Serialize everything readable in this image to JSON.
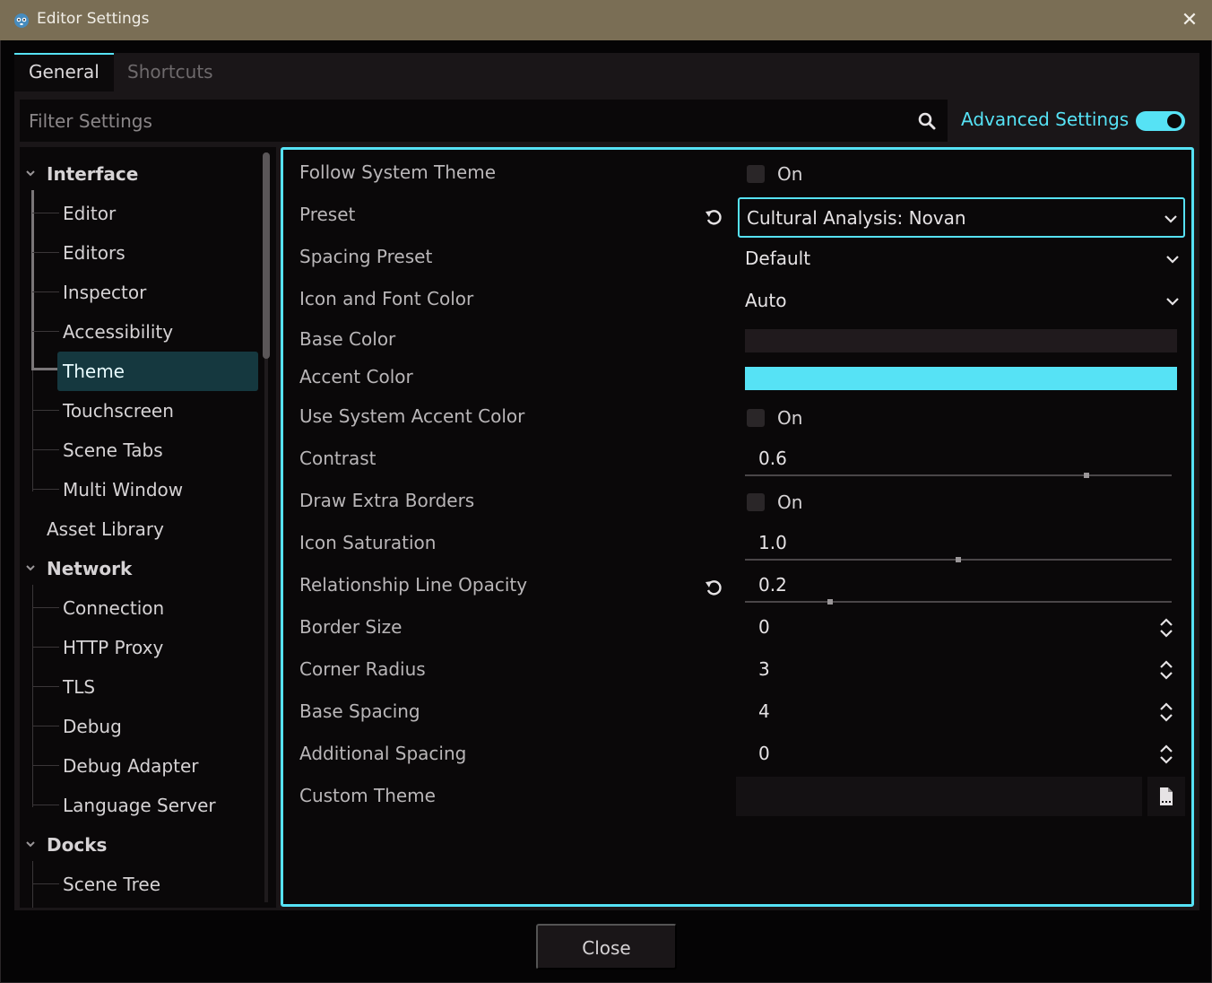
{
  "window": {
    "title": "Editor Settings",
    "close_glyph": "✕",
    "icon": "godot-icon"
  },
  "tabs": [
    {
      "label": "General",
      "active": true
    },
    {
      "label": "Shortcuts",
      "active": false
    }
  ],
  "filter": {
    "placeholder": "Filter Settings",
    "value": ""
  },
  "advanced": {
    "label": "Advanced Settings",
    "enabled": true
  },
  "tree": {
    "categories": [
      {
        "label": "Interface",
        "expanded": true,
        "children": [
          "Editor",
          "Editors",
          "Inspector",
          "Accessibility",
          "Theme",
          "Touchscreen",
          "Scene Tabs",
          "Multi Window"
        ]
      },
      {
        "label": "Asset Library",
        "expanded": false,
        "children": []
      },
      {
        "label": "Network",
        "expanded": true,
        "children": [
          "Connection",
          "HTTP Proxy",
          "TLS",
          "Debug",
          "Debug Adapter",
          "Language Server"
        ]
      },
      {
        "label": "Docks",
        "expanded": true,
        "children": [
          "Scene Tree"
        ]
      }
    ],
    "selected": "Theme"
  },
  "properties": {
    "follow_system_theme": {
      "label": "Follow System Theme",
      "value_label": "On",
      "checked": false
    },
    "preset": {
      "label": "Preset",
      "value": "Cultural Analysis: Novan"
    },
    "spacing_preset": {
      "label": "Spacing Preset",
      "value": "Default"
    },
    "icon_font_color": {
      "label": "Icon and Font Color",
      "value": "Auto"
    },
    "base_color": {
      "label": "Base Color",
      "color": "#201a1d"
    },
    "accent_color": {
      "label": "Accent Color",
      "color": "#56e2f5"
    },
    "use_system_accent": {
      "label": "Use System Accent Color",
      "value_label": "On",
      "checked": false
    },
    "contrast": {
      "label": "Contrast",
      "value": "0.6",
      "fraction": 0.8
    },
    "draw_extra_borders": {
      "label": "Draw Extra Borders",
      "value_label": "On",
      "checked": false
    },
    "icon_saturation": {
      "label": "Icon Saturation",
      "value": "1.0",
      "fraction": 0.5
    },
    "relationship_line_opacity": {
      "label": "Relationship Line Opacity",
      "value": "0.2",
      "fraction": 0.2
    },
    "border_size": {
      "label": "Border Size",
      "value": "0"
    },
    "corner_radius": {
      "label": "Corner Radius",
      "value": "3"
    },
    "base_spacing": {
      "label": "Base Spacing",
      "value": "4"
    },
    "additional_spacing": {
      "label": "Additional Spacing",
      "value": "0"
    },
    "custom_theme": {
      "label": "Custom Theme",
      "value": ""
    }
  },
  "footer": {
    "close_label": "Close"
  },
  "colors": {
    "accent": "#56e2f5",
    "titlebar": "#7a6e55",
    "selection": "#15383f"
  }
}
